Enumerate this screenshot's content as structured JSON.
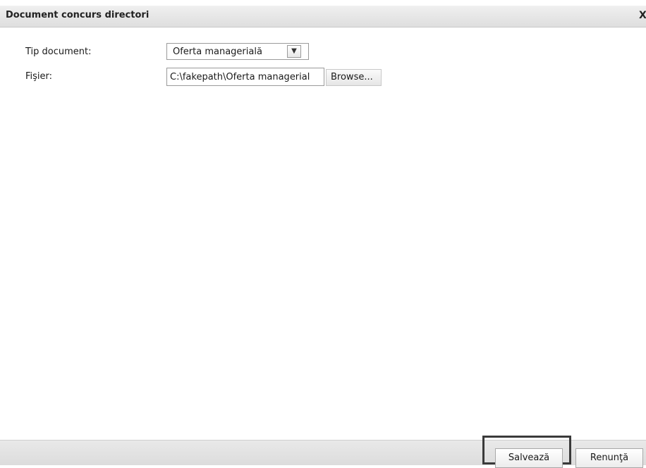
{
  "dialog": {
    "title": "Document concurs directori",
    "close_label": "X"
  },
  "form": {
    "tip_document_label": "Tip document:",
    "tip_document_value": "Oferta managerială",
    "fisier_label": "Fişier:",
    "fisier_value": "C:\\fakepath\\Oferta managerial",
    "browse_label": "Browse..."
  },
  "footer": {
    "save_label": "Salvează",
    "cancel_label": "Renunţă"
  },
  "icons": {
    "dropdown": "chevron-down-icon",
    "close": "close-icon"
  }
}
